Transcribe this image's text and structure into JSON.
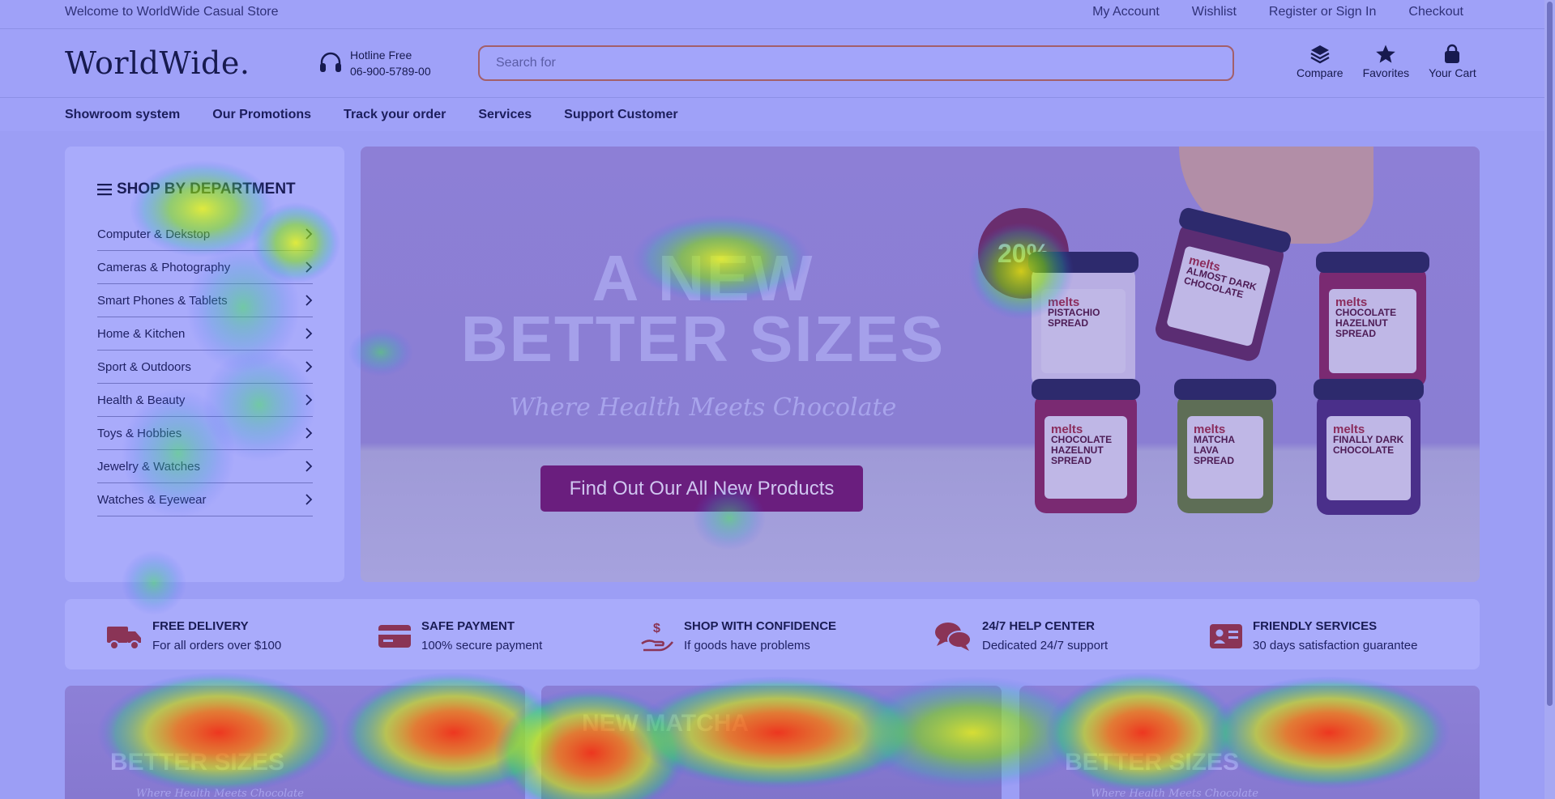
{
  "topbar": {
    "welcome": "Welcome to WorldWide Casual Store",
    "links": [
      "My Account",
      "Wishlist",
      "Register or Sign In",
      "Checkout"
    ]
  },
  "header": {
    "logo": "WorldWide.",
    "hotline_label": "Hotline Free",
    "hotline_number": "06-900-5789-00",
    "search_placeholder": "Search for",
    "icons": [
      {
        "label": "Compare",
        "icon": "layers-icon"
      },
      {
        "label": "Favorites",
        "icon": "star-icon"
      },
      {
        "label": "Your Cart",
        "icon": "bag-icon"
      }
    ]
  },
  "nav": [
    "Showroom system",
    "Our Promotions",
    "Track your order",
    "Services",
    "Support Customer"
  ],
  "sidebar": {
    "title": "SHOP BY DEPARTMENT",
    "items": [
      "Computer & Dekstop",
      "Cameras & Photography",
      "Smart Phones & Tablets",
      "Home & Kitchen",
      "Sport & Outdoors",
      "Health & Beauty",
      "Toys & Hobbies",
      "Jewelry & Watches",
      "Watches & Eyewear"
    ]
  },
  "hero": {
    "line1": "A NEW",
    "line2": "BETTER SIZES",
    "tagline": "Where Health Meets Chocolate",
    "cta": "Find Out Our All New Products",
    "badge": "20%",
    "jars": [
      {
        "brand": "melts",
        "name": "PISTACHIO SPREAD"
      },
      {
        "brand": "melts",
        "name": "ALMOST DARK CHOCOLATE"
      },
      {
        "brand": "melts",
        "name": "CHOCOLATE HAZELNUT SPREAD"
      },
      {
        "brand": "melts",
        "name": "CHOCOLATE HAZELNUT SPREAD"
      },
      {
        "brand": "melts",
        "name": "MATCHA LAVA SPREAD"
      },
      {
        "brand": "melts",
        "name": "FINALLY DARK CHOCOLATE"
      }
    ]
  },
  "features": [
    {
      "title": "FREE DELIVERY",
      "sub": "For all orders over $100",
      "icon": "truck-icon"
    },
    {
      "title": "SAFE PAYMENT",
      "sub": "100% secure payment",
      "icon": "credit-card-icon"
    },
    {
      "title": "SHOP WITH CONFIDENCE",
      "sub": "If goods have problems",
      "icon": "hand-dollar-icon"
    },
    {
      "title": "24/7 HELP CENTER",
      "sub": "Dedicated 24/7 support",
      "icon": "chat-bubbles-icon"
    },
    {
      "title": "FRIENDLY SERVICES",
      "sub": "30 days satisfaction guarantee",
      "icon": "id-card-icon"
    }
  ],
  "promos": [
    {
      "title": "BETTER SIZES",
      "sub": "Where Health Meets Chocolate"
    },
    {
      "title": "NEW MATCHA",
      "sub": ""
    },
    {
      "title": "BETTER SIZES",
      "sub": "Where Health Meets Chocolate"
    }
  ],
  "colors": {
    "accent": "#6a1e7e",
    "search_border": "#a35f6a",
    "overlay": "#9c9ef5"
  }
}
